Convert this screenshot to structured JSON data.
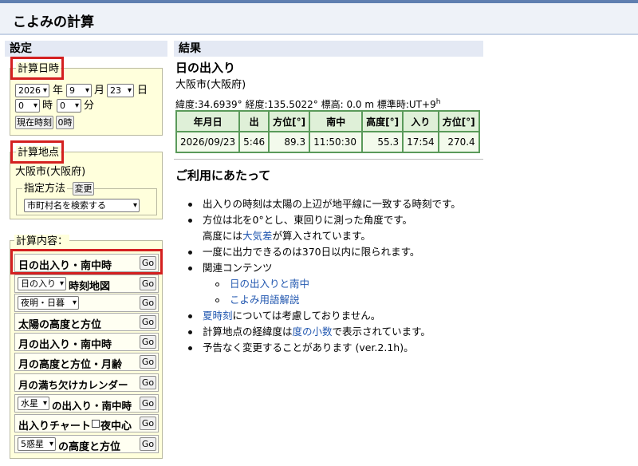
{
  "page_title": "こよみの計算",
  "left_header": "設定",
  "right_header": "結果",
  "datetime": {
    "legend": "計算日時",
    "year_value": "2026",
    "year_unit": "年",
    "month_value": "9",
    "month_unit": "月",
    "day_value": "23",
    "day_unit": "日",
    "hour_value": "0",
    "hour_unit": "時",
    "minute_value": "0",
    "minute_unit": "分",
    "now_button": "現在時刻",
    "zero_button": "0時"
  },
  "location": {
    "legend": "計算地点",
    "place_name": "大阪市(大阪府)",
    "method_legend": "指定方法",
    "change_button": "変更",
    "search_select": "市町村名を検索する"
  },
  "calc": {
    "legend": "計算内容：",
    "go_label": "Go",
    "rows": [
      {
        "label": "日の出入り・南中時"
      },
      {
        "select": "日の入り",
        "label": "時刻地図"
      },
      {
        "select": "夜明・日暮"
      },
      {
        "label": "太陽の高度と方位"
      },
      {
        "label": "月の出入り・南中時"
      },
      {
        "label": "月の高度と方位・月齢"
      },
      {
        "label": "月の満ち欠けカレンダー"
      },
      {
        "select": "水星",
        "label": "の出入り・南中時"
      },
      {
        "label": "出入りチャート",
        "check_label": "夜中心"
      },
      {
        "select": "5惑星",
        "label": "の高度と方位"
      }
    ]
  },
  "result": {
    "title": "日の出入り",
    "place": "大阪市(大阪府)",
    "coords": "緯度:34.6939° 経度:135.5022° 標高: 0.0 m 標準時:UT+9",
    "coords_sup": "h",
    "table": {
      "headers": [
        "年月日",
        "出",
        "方位[°]",
        "南中",
        "高度[°]",
        "入り",
        "方位[°]"
      ],
      "row": [
        "2026/09/23",
        "5:46",
        "89.3",
        "11:50:30",
        "55.3",
        "17:54",
        "270.4"
      ]
    }
  },
  "notes": {
    "title": "ご利用にあたって",
    "b1": "出入りの時刻は太陽の上辺が地平線に一致する時刻です。",
    "b2": "方位は北を0°とし、東回りに測った角度です。",
    "b2b_pre": "高度には",
    "b2b_link": "大気差",
    "b2b_post": "が算入されています。",
    "b3": "一度に出力できるのは370日以内に限られます。",
    "b4": "関連コンテンツ",
    "sub1": "日の出入りと南中",
    "sub2": "こよみ用語解説",
    "b5_link": "夏時刻",
    "b5_post": "については考慮しておりません。",
    "b6_pre": "計算地点の経緯度は",
    "b6_link": "度の小数",
    "b6_post": "で表示されています。",
    "b7": "予告なく変更することがあります (ver.2.1h)。"
  }
}
